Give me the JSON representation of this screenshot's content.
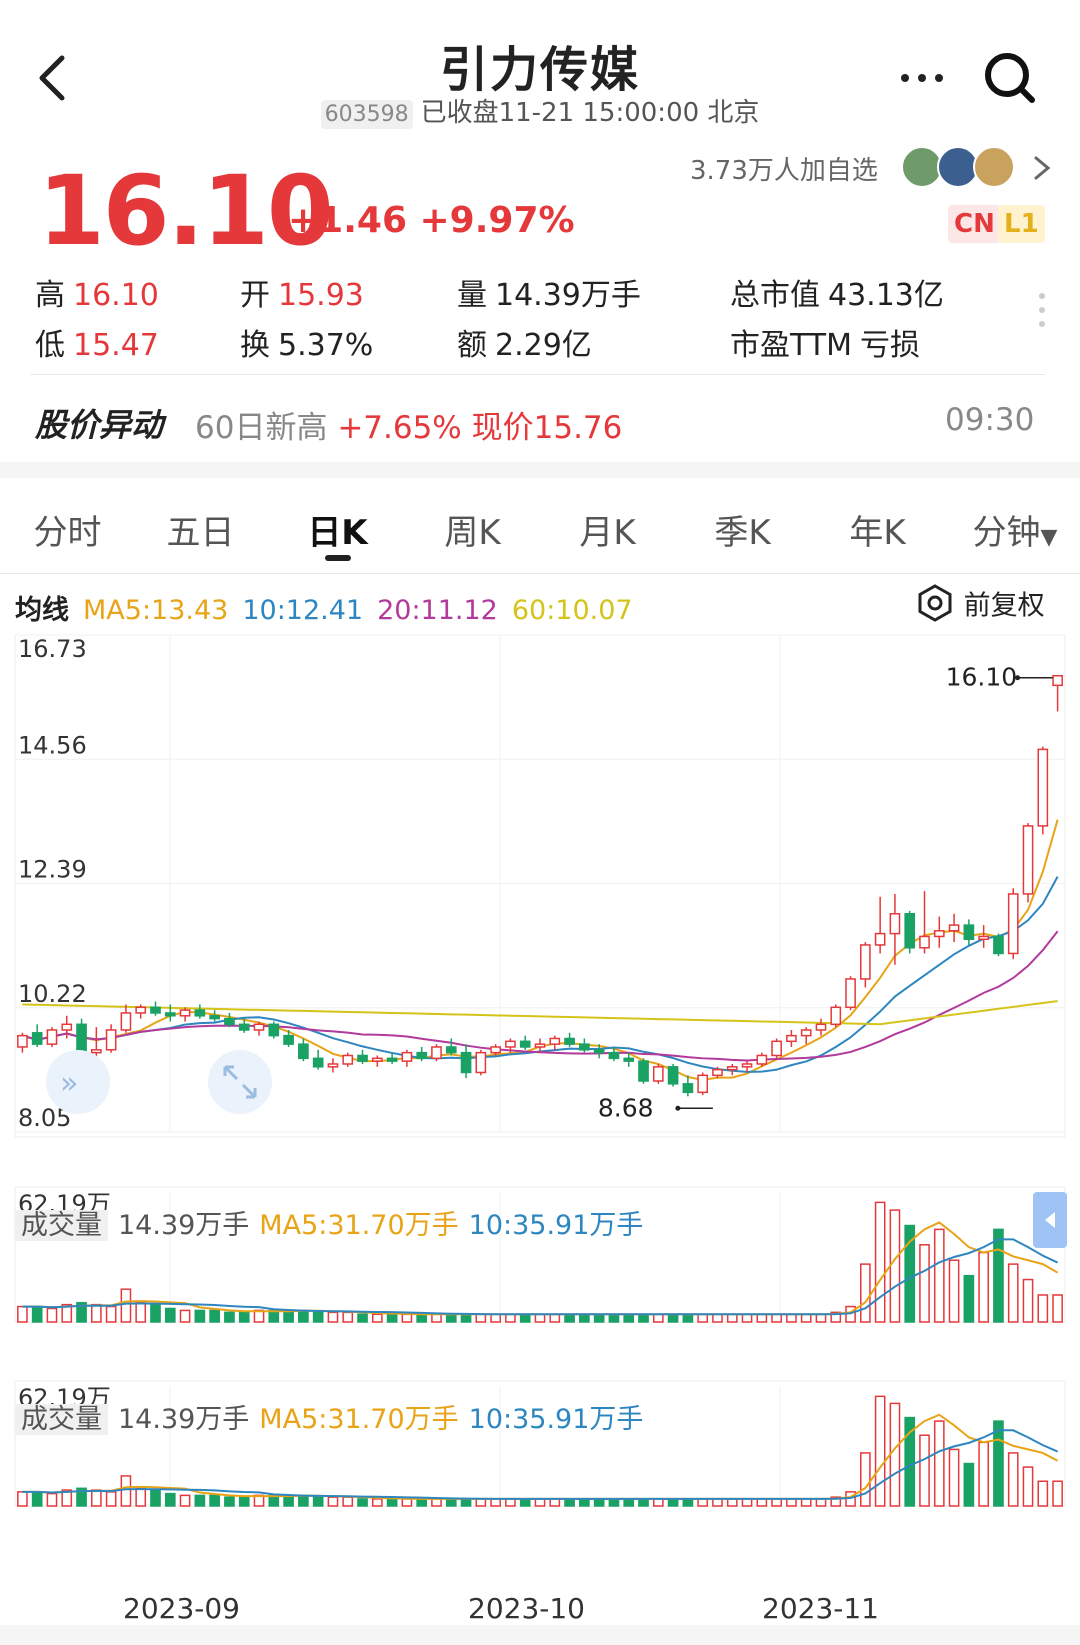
{
  "header": {
    "title": "引力传媒",
    "code": "603598",
    "status": "已收盘11-21 15:00:00 北京"
  },
  "quote": {
    "price": "16.10",
    "change": "+1.46 +9.97%",
    "watchers": "3.73万人加自选",
    "badge_cn": "CN",
    "badge_l1": "L1"
  },
  "stats": {
    "high_label": "高",
    "high": "16.10",
    "open_label": "开",
    "open": "15.93",
    "volume_label": "量",
    "volume": "14.39万手",
    "mktcap_label": "总市值",
    "mktcap": "43.13亿",
    "low_label": "低",
    "low": "15.47",
    "turnover_label": "换",
    "turnover": "5.37%",
    "amount_label": "额",
    "amount": "2.29亿",
    "pe_label": "市盈TTM",
    "pe": "亏损"
  },
  "alert": {
    "title": "股价异动",
    "prefix": "60日新高",
    "highlight": "+7.65% 现价15.76",
    "time": "09:30"
  },
  "tabs": [
    "分时",
    "五日",
    "日K",
    "周K",
    "月K",
    "季K",
    "年K",
    "分钟"
  ],
  "active_tab": "日K",
  "ma_legend": {
    "label": "均线",
    "ma5": "MA5:13.43",
    "ma10": "10:12.41",
    "ma20": "20:11.12",
    "ma60": "60:10.07"
  },
  "adjust_label": "前复权",
  "volume_legend": {
    "label": "成交量",
    "value": "14.39万手",
    "ma5": "MA5:31.70万手",
    "ma10": "10:35.91万手"
  },
  "colors": {
    "up": "#e5383b",
    "down": "#1aa164",
    "ma5": "#e8a317",
    "ma10": "#2e86c1",
    "ma20": "#b23a9b",
    "ma60": "#d4c41a"
  },
  "chart_data": [
    {
      "type": "candlestick",
      "title": "",
      "y_ticks": [
        "16.73",
        "14.56",
        "12.39",
        "10.22",
        "8.05"
      ],
      "ylim": [
        8.05,
        16.73
      ],
      "x_ticks": [
        "2023-09",
        "2023-10",
        "2023-11"
      ],
      "annotations": [
        {
          "label": "16.10",
          "value": 16.1
        },
        {
          "label": "8.68",
          "value": 8.68
        }
      ],
      "ohlc": [
        [
          9.55,
          9.8,
          9.45,
          9.75
        ],
        [
          9.8,
          9.95,
          9.55,
          9.6
        ],
        [
          9.6,
          9.9,
          9.55,
          9.85
        ],
        [
          9.85,
          10.1,
          9.7,
          9.95
        ],
        [
          9.95,
          10.05,
          9.4,
          9.45
        ],
        [
          9.45,
          9.9,
          9.35,
          9.5
        ],
        [
          9.5,
          9.95,
          9.45,
          9.85
        ],
        [
          9.85,
          10.3,
          9.8,
          10.15
        ],
        [
          10.15,
          10.3,
          10.05,
          10.25
        ],
        [
          10.25,
          10.35,
          10.1,
          10.15
        ],
        [
          10.15,
          10.3,
          10.0,
          10.1
        ],
        [
          10.1,
          10.25,
          10.0,
          10.2
        ],
        [
          10.2,
          10.3,
          10.05,
          10.1
        ],
        [
          10.1,
          10.2,
          10.0,
          10.05
        ],
        [
          10.05,
          10.15,
          9.9,
          9.95
        ],
        [
          9.95,
          10.05,
          9.8,
          9.85
        ],
        [
          9.85,
          10.0,
          9.75,
          9.95
        ],
        [
          9.95,
          10.0,
          9.7,
          9.75
        ],
        [
          9.75,
          9.85,
          9.55,
          9.6
        ],
        [
          9.6,
          9.7,
          9.3,
          9.35
        ],
        [
          9.35,
          9.5,
          9.15,
          9.2
        ],
        [
          9.2,
          9.35,
          9.1,
          9.25
        ],
        [
          9.25,
          9.45,
          9.2,
          9.4
        ],
        [
          9.4,
          9.5,
          9.25,
          9.3
        ],
        [
          9.3,
          9.4,
          9.2,
          9.35
        ],
        [
          9.35,
          9.45,
          9.25,
          9.3
        ],
        [
          9.3,
          9.5,
          9.2,
          9.45
        ],
        [
          9.45,
          9.55,
          9.3,
          9.35
        ],
        [
          9.35,
          9.6,
          9.3,
          9.55
        ],
        [
          9.55,
          9.7,
          9.4,
          9.45
        ],
        [
          9.45,
          9.6,
          9.0,
          9.1
        ],
        [
          9.1,
          9.5,
          9.05,
          9.45
        ],
        [
          9.45,
          9.6,
          9.4,
          9.55
        ],
        [
          9.55,
          9.7,
          9.45,
          9.65
        ],
        [
          9.65,
          9.75,
          9.5,
          9.55
        ],
        [
          9.55,
          9.7,
          9.45,
          9.6
        ],
        [
          9.6,
          9.75,
          9.5,
          9.7
        ],
        [
          9.7,
          9.8,
          9.55,
          9.6
        ],
        [
          9.6,
          9.7,
          9.45,
          9.5
        ],
        [
          9.5,
          9.6,
          9.35,
          9.45
        ],
        [
          9.45,
          9.55,
          9.3,
          9.35
        ],
        [
          9.35,
          9.45,
          9.2,
          9.3
        ],
        [
          9.3,
          9.35,
          8.9,
          8.95
        ],
        [
          8.95,
          9.25,
          8.9,
          9.2
        ],
        [
          9.2,
          9.25,
          8.85,
          8.9
        ],
        [
          8.9,
          9.05,
          8.68,
          8.75
        ],
        [
          8.75,
          9.1,
          8.7,
          9.05
        ],
        [
          9.05,
          9.2,
          9.0,
          9.15
        ],
        [
          9.15,
          9.25,
          9.05,
          9.2
        ],
        [
          9.2,
          9.3,
          9.1,
          9.25
        ],
        [
          9.25,
          9.45,
          9.2,
          9.4
        ],
        [
          9.4,
          9.7,
          9.35,
          9.65
        ],
        [
          9.65,
          9.85,
          9.55,
          9.75
        ],
        [
          9.75,
          9.9,
          9.6,
          9.85
        ],
        [
          9.85,
          10.05,
          9.75,
          9.95
        ],
        [
          9.95,
          10.3,
          9.9,
          10.25
        ],
        [
          10.25,
          10.8,
          10.2,
          10.75
        ],
        [
          10.75,
          11.4,
          10.6,
          11.35
        ],
        [
          11.35,
          12.2,
          11.2,
          11.55
        ],
        [
          11.55,
          12.25,
          11.0,
          11.9
        ],
        [
          11.9,
          11.95,
          11.2,
          11.3
        ],
        [
          11.3,
          12.3,
          11.2,
          11.5
        ],
        [
          11.5,
          11.85,
          11.3,
          11.6
        ],
        [
          11.6,
          11.9,
          11.4,
          11.7
        ],
        [
          11.7,
          11.8,
          11.35,
          11.45
        ],
        [
          11.45,
          11.7,
          11.3,
          11.5
        ],
        [
          11.5,
          11.55,
          11.15,
          11.2
        ],
        [
          11.2,
          12.35,
          11.1,
          12.25
        ],
        [
          12.25,
          13.5,
          12.1,
          13.45
        ],
        [
          13.45,
          14.85,
          13.3,
          14.8
        ],
        [
          15.93,
          16.1,
          15.47,
          16.1
        ]
      ]
    },
    {
      "type": "bar",
      "title": "成交量",
      "y_ticks": [
        "62.19万"
      ],
      "ylim": [
        0,
        62.19
      ],
      "unit": "万手",
      "values": [
        8,
        8,
        7,
        9,
        10,
        9,
        8,
        17,
        10,
        9,
        7,
        6,
        6,
        6,
        5,
        5,
        6,
        6,
        6,
        6,
        5,
        5,
        5,
        4,
        4,
        4,
        4,
        4,
        4,
        4,
        4,
        4,
        4,
        4,
        4,
        4,
        4,
        4,
        4,
        4,
        4,
        4,
        4,
        4,
        4,
        4,
        4,
        4,
        4,
        4,
        4,
        4,
        4,
        4,
        4,
        5,
        8,
        30,
        62,
        58,
        50,
        40,
        48,
        32,
        24,
        36,
        48,
        30,
        22,
        14,
        14
      ]
    },
    {
      "type": "bar",
      "title": "成交量",
      "y_ticks": [
        "62.19万"
      ],
      "ylim": [
        0,
        62.19
      ],
      "unit": "万手",
      "values": [
        8,
        8,
        7,
        9,
        10,
        9,
        8,
        17,
        10,
        9,
        7,
        6,
        6,
        6,
        5,
        5,
        6,
        6,
        6,
        6,
        5,
        5,
        5,
        4,
        4,
        4,
        4,
        4,
        4,
        4,
        4,
        4,
        4,
        4,
        4,
        4,
        4,
        4,
        4,
        4,
        4,
        4,
        4,
        4,
        4,
        4,
        4,
        4,
        4,
        4,
        4,
        4,
        4,
        4,
        4,
        5,
        8,
        30,
        62,
        58,
        50,
        40,
        48,
        32,
        24,
        36,
        48,
        30,
        22,
        14,
        14
      ]
    }
  ]
}
